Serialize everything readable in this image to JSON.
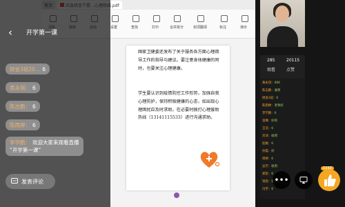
{
  "browser": {
    "tabs": [
      {
        "label": "首页"
      },
      {
        "label": "应急状态下提…心理热线.pdf"
      }
    ]
  },
  "toolbar": {
    "labels": [
      "清除",
      "旋转",
      "自动",
      "设置",
      "查找",
      "打印",
      "合并拆分",
      "划词翻译",
      "标注",
      "演示"
    ]
  },
  "document": {
    "paragraphs": [
      "国家卫健委还发布了关于服务各方面心理疏导工作的指导与建议。要注意身体健康的同时，也要关注心理健康。",
      "学生要认识到疫情防控工作形势，加强自我心理防护，保持积极健康的心态，如出现心理困扰应及时求助。在必要时拨打心理援助热线（13141115533）进行沟通求助。"
    ],
    "page_number": ""
  },
  "header": {
    "title": "开学第一课"
  },
  "chat": [
    {
      "name": "财会3班20…",
      "body": "6"
    },
    {
      "name": "黄永琪：",
      "body": "6"
    },
    {
      "name": "陈志鹏：",
      "body": "6"
    },
    {
      "name": "陈雨婷：",
      "body": "6"
    },
    {
      "name": "李学鹏：",
      "body": "欢迎大家来观看直播"
    }
  ],
  "chat_extra": "“开学第一课”",
  "comment_button": {
    "label": "发表评论"
  },
  "stats": {
    "left_value": "285",
    "right_value": "20115",
    "left_label": "观看",
    "right_label": "点赞"
  },
  "danmaku": [
    {
      "name": "黄永琪：",
      "text": "666"
    },
    {
      "name": "陈志鹏：",
      "text": "收到"
    },
    {
      "name": "财会3班：",
      "text": "6"
    },
    {
      "name": "陈雨婷：",
      "text": "老师好"
    },
    {
      "name": "李学鹏：",
      "text": "6"
    },
    {
      "name": "张琳：",
      "text": "好的"
    },
    {
      "name": "王浩：",
      "text": "6"
    },
    {
      "name": "刘洋：",
      "text": "收到"
    },
    {
      "name": "赵敏：",
      "text": "6"
    },
    {
      "name": "孙磊：",
      "text": "好"
    },
    {
      "name": "周婷：",
      "text": "6"
    },
    {
      "name": "吴芳：",
      "text": "收到"
    },
    {
      "name": "郑凯：",
      "text": "6"
    },
    {
      "name": "钱悦：",
      "text": "谢谢老师"
    },
    {
      "name": "冯宇：",
      "text": "6"
    }
  ],
  "like_count": "2232",
  "colors": {
    "accent": "#f5a623",
    "name_color": "#f0b16a",
    "danmaku_name": "#f0a030",
    "danmaku_text": "#9ed36a",
    "note_red": "#c0392b"
  },
  "icons": {
    "back": "chevron-left-icon",
    "comment": "comment-icon",
    "more": "more-icon",
    "cast": "cast-icon",
    "like": "thumbs-up-icon"
  }
}
